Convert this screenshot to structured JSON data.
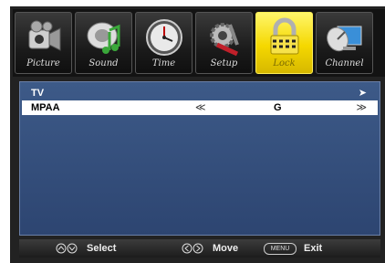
{
  "tabs": [
    {
      "label": "Picture",
      "icon": "camcorder-icon",
      "active": false
    },
    {
      "label": "Sound",
      "icon": "music-note-icon",
      "active": false
    },
    {
      "label": "Time",
      "icon": "clock-icon",
      "active": false
    },
    {
      "label": "Setup",
      "icon": "tools-icon",
      "active": false
    },
    {
      "label": "Lock",
      "icon": "padlock-icon",
      "active": true
    },
    {
      "label": "Channel",
      "icon": "satellite-dish-icon",
      "active": false
    }
  ],
  "menu": {
    "tv_label": "TV",
    "tv_arrow": "➤",
    "mpaa_label": "MPAA",
    "mpaa_left": "≪",
    "mpaa_value": "G",
    "mpaa_right": "≫"
  },
  "help": {
    "select_label": "Select",
    "move_label": "Move",
    "menu_key": "MENU",
    "exit_label": "Exit"
  },
  "colors": {
    "active_tab": "#f5d800",
    "list_background": "#3a5583",
    "selected_row": "#ffffff"
  }
}
